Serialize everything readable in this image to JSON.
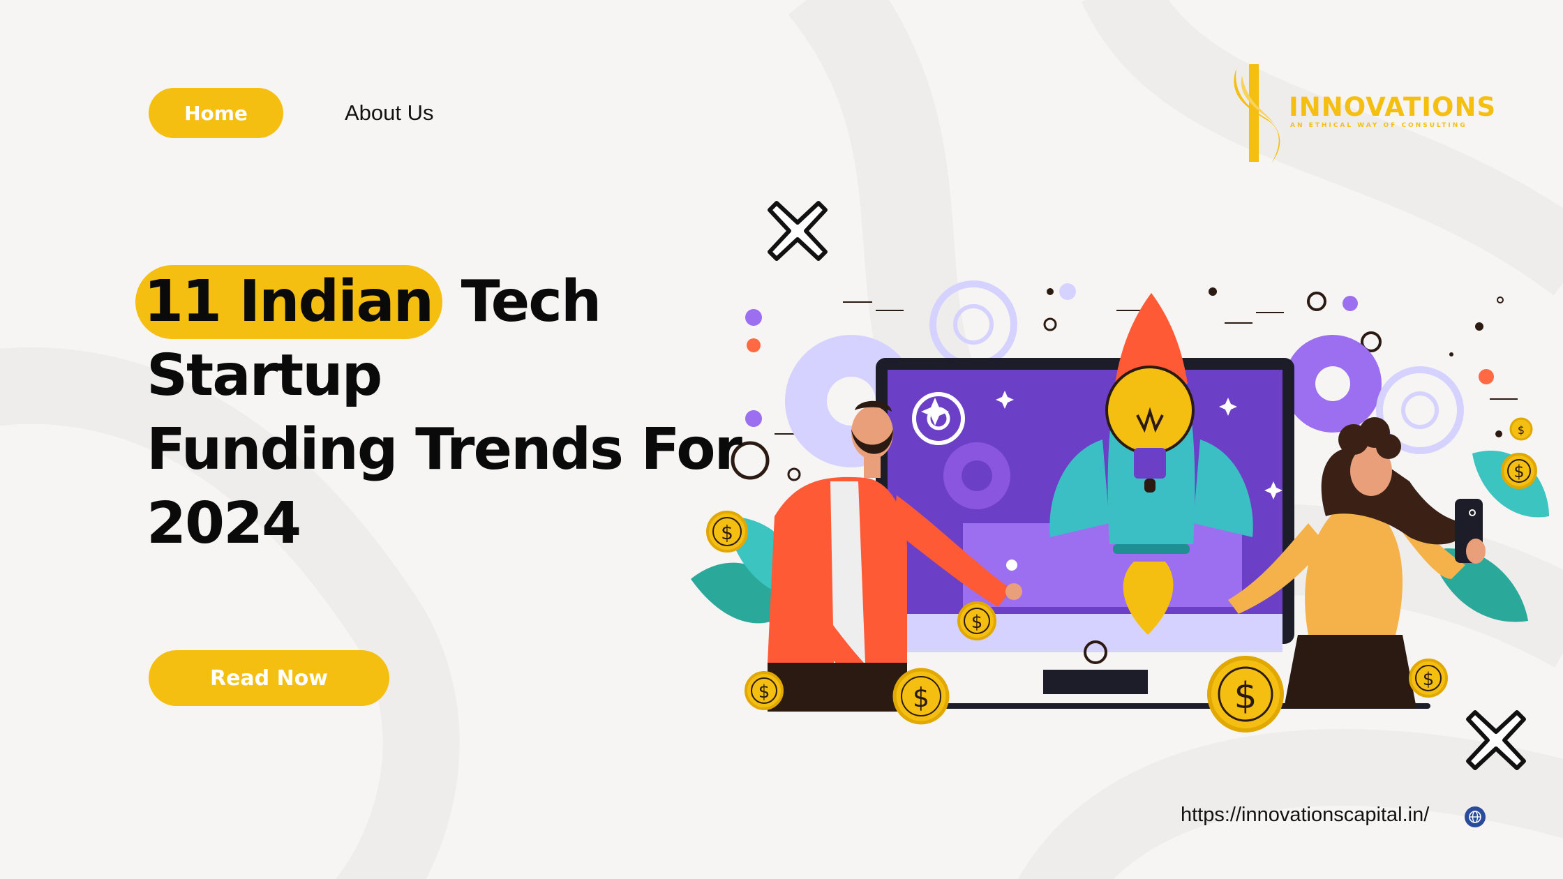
{
  "nav": {
    "home_label": "Home",
    "about_label": "About Us"
  },
  "brand": {
    "name": "INNOVATIONS",
    "tagline": "AN ETHICAL WAY OF CONSULTING"
  },
  "headline": {
    "highlight": "11 Indian",
    "line1_rest": " Tech Startup",
    "line2": "Funding Trends For",
    "line3": "2024"
  },
  "cta": {
    "read_now_label": "Read Now"
  },
  "footer": {
    "url": "https://innovationscapital.in/"
  },
  "illustration": {
    "coin_symbol": "$"
  },
  "colors": {
    "accent": "#f5bf12",
    "background": "#f7f5f4",
    "text": "#0a0a0a",
    "purple": "#6c3fc7",
    "teal": "#3cbfc4",
    "orange": "#ff5a36"
  },
  "icons": [
    "close-x-icon",
    "globe-icon",
    "gear-icon",
    "rocket-icon",
    "lightbulb-icon",
    "dollar-coin-icon",
    "smartphone-icon"
  ]
}
